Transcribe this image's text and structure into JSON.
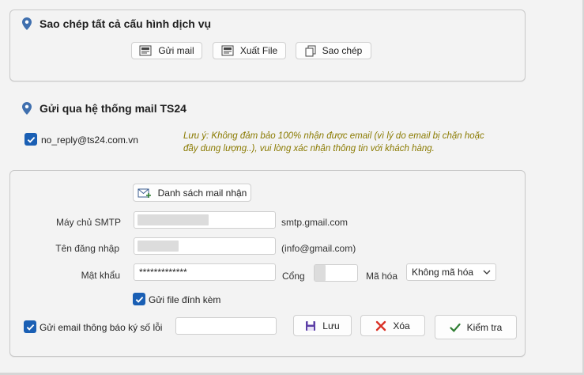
{
  "copy_section": {
    "title": "Sao chép tất cả cấu hình dịch vụ",
    "send_mail_label": "Gửi mail",
    "export_file_label": "Xuất File",
    "copy_label": "Sao chép"
  },
  "mail_section": {
    "title": "Gửi qua hệ thống mail TS24",
    "sender_checked": true,
    "sender_email": "no_reply@ts24.com.vn",
    "note": "Lưu ý: Không đảm bảo 100% nhận được email (vì lý do email bị chặn hoặc đầy dung lượng..), vui lòng xác nhận thông tin với khách hàng."
  },
  "smtp_form": {
    "recipient_list_label": "Danh sách mail nhận",
    "smtp_server_label": "Máy chủ SMTP",
    "smtp_server_hint": "smtp.gmail.com",
    "username_label": "Tên đăng nhập",
    "username_hint": "(info@gmail.com)",
    "password_label": "Mật khẩu",
    "password_value": "*************",
    "port_label": "Cổng",
    "encryption_label": "Mã hóa",
    "encryption_value": "Không mã hóa",
    "attach_checked": true,
    "attach_label": "Gửi file đính kèm",
    "error_notify_checked": true,
    "error_notify_label": "Gửi email thông báo ký số lỗi",
    "save_label": "Lưu",
    "delete_label": "Xóa",
    "test_label": "Kiểm tra"
  },
  "colors": {
    "accent": "#1a5fb4",
    "note": "#8a7a00",
    "delete_icon": "#d93025",
    "check_icon": "#2e7d32"
  }
}
